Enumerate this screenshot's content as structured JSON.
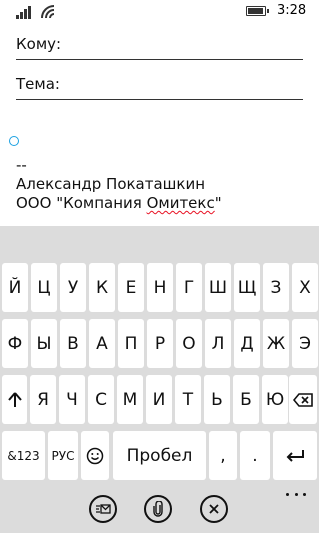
{
  "status_bar": {
    "time": "3:28",
    "signal_icon": "signal-strength-icon",
    "wifi_icon": "wifi-icon",
    "battery_icon": "battery-icon"
  },
  "compose": {
    "to_label": "Кому:",
    "subject_label": "Тема:",
    "signature_lines": [
      "--",
      "Александр Покаташкин"
    ],
    "company_prefix": "ООО \"Компания ",
    "company_misspelled": "Омитекс",
    "company_suffix": "\""
  },
  "keyboard": {
    "row1": [
      "Й",
      "Ц",
      "У",
      "К",
      "Е",
      "Н",
      "Г",
      "Ш",
      "Щ",
      "З",
      "Х"
    ],
    "row2": [
      "Ф",
      "Ы",
      "В",
      "А",
      "П",
      "Р",
      "О",
      "Л",
      "Д",
      "Ж",
      "Э"
    ],
    "row3": [
      "Я",
      "Ч",
      "С",
      "М",
      "И",
      "Т",
      "Ь",
      "Б",
      "Ю"
    ],
    "numbers_key": "&123",
    "language_key": "РУС",
    "space_key": "Пробел",
    "comma_key": ",",
    "period_key": ".",
    "shift_icon": "shift-arrow-icon",
    "backspace_icon": "backspace-icon",
    "enter_icon": "enter-return-icon",
    "emoji_icon": "smiley-icon"
  },
  "app_bar": {
    "send_icon": "send-mail-icon",
    "attach_icon": "paperclip-icon",
    "discard_icon": "close-icon",
    "more_icon": "more-dots-icon"
  }
}
